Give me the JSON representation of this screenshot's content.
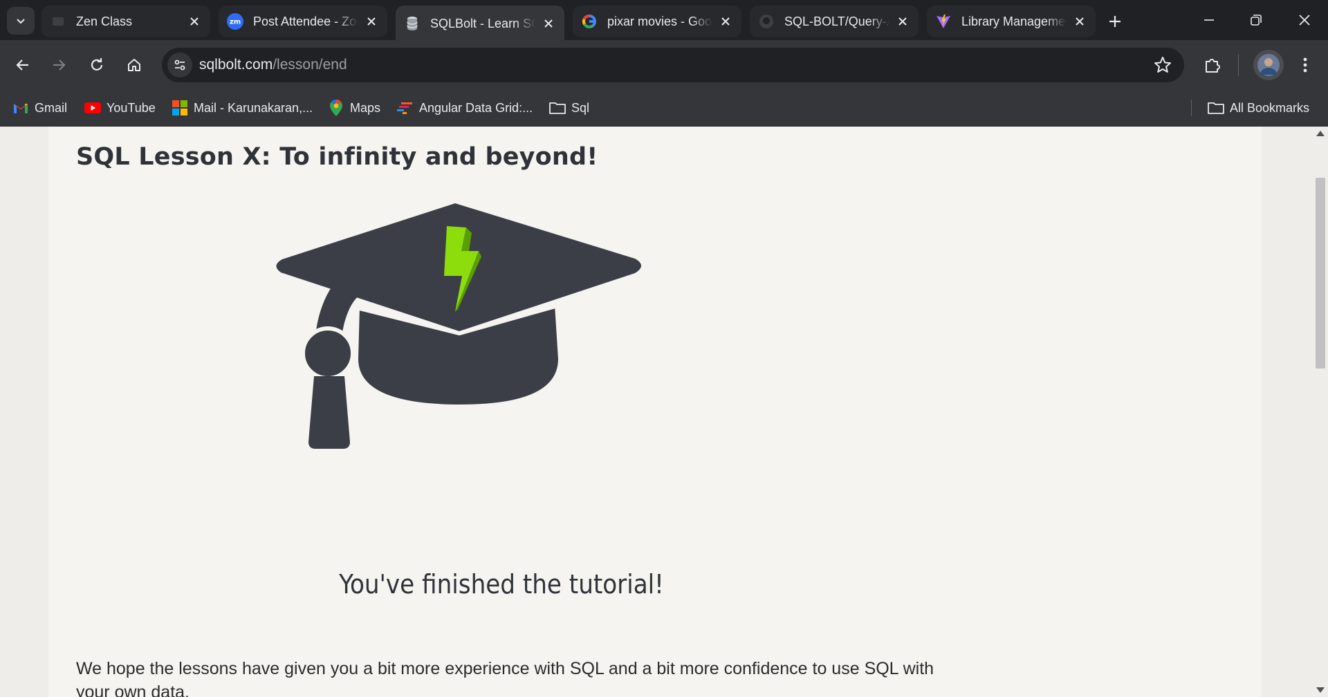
{
  "browser": {
    "tabs": [
      {
        "title": "Zen Class",
        "favicon": "zen-class-icon",
        "active": false
      },
      {
        "title": "Post Attendee - Zoom",
        "favicon": "zoom-icon",
        "active": false
      },
      {
        "title": "SQLBolt - Learn SQL",
        "favicon": "sqlbolt-database-icon",
        "active": true
      },
      {
        "title": "pixar movies - Google Search",
        "favicon": "google-icon",
        "active": false
      },
      {
        "title": "SQL-BOLT/Query-All",
        "favicon": "github-icon",
        "active": false
      },
      {
        "title": "Library Management",
        "favicon": "vite-icon",
        "active": false
      }
    ],
    "address_bar": {
      "domain": "sqlbolt.com",
      "path": "/lesson/end"
    },
    "bookmarks": [
      {
        "label": "Gmail",
        "icon": "gmail-icon"
      },
      {
        "label": "YouTube",
        "icon": "youtube-icon"
      },
      {
        "label": "Mail - Karunakaran,...",
        "icon": "microsoft-icon"
      },
      {
        "label": "Maps",
        "icon": "maps-pin-icon"
      },
      {
        "label": "Angular Data Grid:...",
        "icon": "ag-grid-icon"
      },
      {
        "label": "Sql",
        "icon": "folder-icon"
      }
    ],
    "all_bookmarks_label": "All Bookmarks"
  },
  "page": {
    "title": "SQL Lesson X: To infinity and beyond!",
    "image": "graduation-cap-lightning-icon",
    "subtitle": "You've finished the tutorial!",
    "paragraph": "We hope the lessons have given you a bit more experience with SQL and a bit more confidence to use SQL with your own data."
  },
  "colors": {
    "tab_strip": "#202124",
    "toolbar": "#35363a",
    "page_bg": "#efedea",
    "content_bg": "#f5f4f1",
    "cap": "#3b3e47",
    "bolt": "#8ddc0c"
  }
}
